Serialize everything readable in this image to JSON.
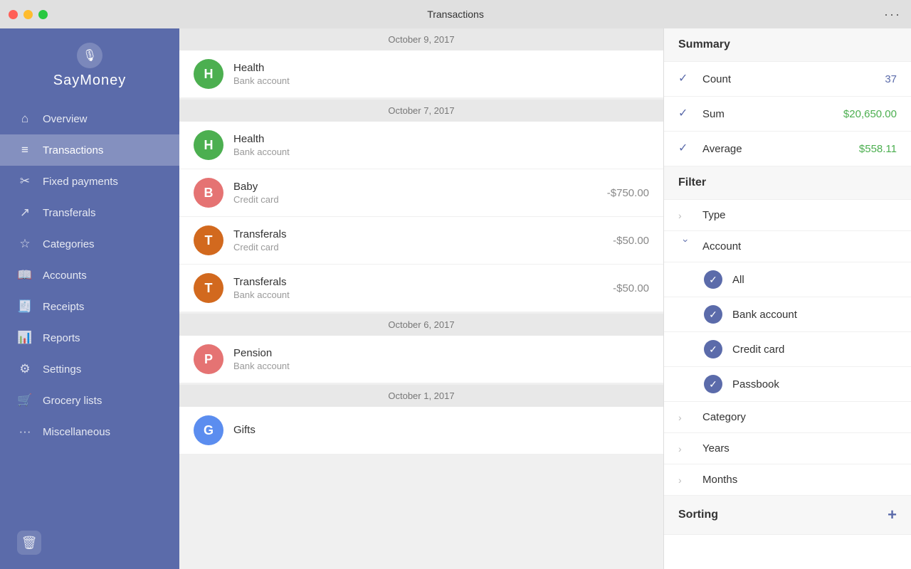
{
  "titlebar": {
    "title": "Transactions",
    "more_icon": "···"
  },
  "sidebar": {
    "logo_text": "SayMoney",
    "nav_items": [
      {
        "id": "overview",
        "label": "Overview",
        "icon": "⌂"
      },
      {
        "id": "transactions",
        "label": "Transactions",
        "icon": "≡",
        "active": true
      },
      {
        "id": "fixed-payments",
        "label": "Fixed payments",
        "icon": "✂"
      },
      {
        "id": "transferals",
        "label": "Transferals",
        "icon": "↗"
      },
      {
        "id": "categories",
        "label": "Categories",
        "icon": "☆"
      },
      {
        "id": "accounts",
        "label": "Accounts",
        "icon": "📖"
      },
      {
        "id": "receipts",
        "label": "Receipts",
        "icon": "🧾"
      },
      {
        "id": "reports",
        "label": "Reports",
        "icon": "📊"
      },
      {
        "id": "settings",
        "label": "Settings",
        "icon": "⚙"
      },
      {
        "id": "grocery",
        "label": "Grocery lists",
        "icon": "🛒"
      },
      {
        "id": "misc",
        "label": "Miscellaneous",
        "icon": "···"
      }
    ],
    "delete_icon": "🗑"
  },
  "transactions": {
    "groups": [
      {
        "date": "October 9, 2017",
        "items": [
          {
            "avatar_letter": "H",
            "avatar_color": "green",
            "name": "Health",
            "account": "Bank account",
            "amount": ""
          }
        ]
      },
      {
        "date": "October 7, 2017",
        "items": [
          {
            "avatar_letter": "H",
            "avatar_color": "green",
            "name": "Health",
            "account": "Bank account",
            "amount": ""
          },
          {
            "avatar_letter": "B",
            "avatar_color": "pink",
            "name": "Baby",
            "account": "Credit card",
            "amount": "-$750.00"
          },
          {
            "avatar_letter": "T",
            "avatar_color": "orange",
            "name": "Transferals",
            "account": "Credit card",
            "amount": "-$50.00"
          },
          {
            "avatar_letter": "T",
            "avatar_color": "orange",
            "name": "Transferals",
            "account": "Bank account",
            "amount": "-$50.00"
          }
        ]
      },
      {
        "date": "October 6, 2017",
        "items": [
          {
            "avatar_letter": "P",
            "avatar_color": "pink",
            "name": "Pension",
            "account": "Bank account",
            "amount": ""
          }
        ]
      },
      {
        "date": "October 1, 2017",
        "items": [
          {
            "avatar_letter": "G",
            "avatar_color": "blue",
            "name": "Gifts",
            "account": "",
            "amount": ""
          }
        ]
      }
    ]
  },
  "right_panel": {
    "summary_label": "Summary",
    "count_label": "Count",
    "count_value": "37",
    "sum_label": "Sum",
    "sum_value": "$20,650.00",
    "average_label": "Average",
    "average_value": "$558.11",
    "filter_label": "Filter",
    "type_label": "Type",
    "account_label": "Account",
    "all_label": "All",
    "bank_account_label": "Bank account",
    "credit_card_label": "Credit card",
    "passbook_label": "Passbook",
    "category_label": "Category",
    "years_label": "Years",
    "months_label": "Months",
    "sorting_label": "Sorting",
    "add_icon": "+"
  }
}
